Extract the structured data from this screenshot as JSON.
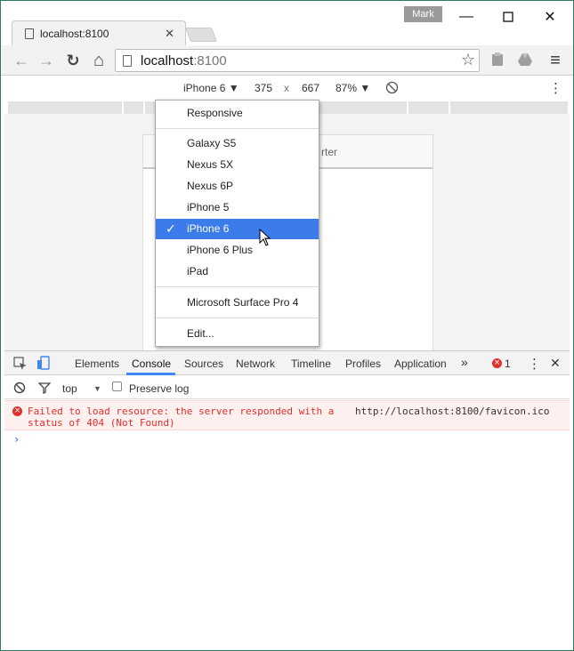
{
  "window": {
    "profile_name": "Mark",
    "minimize_glyph": "—",
    "maximize_glyph": "☐",
    "close_glyph": "✕"
  },
  "tab": {
    "title": "localhost:8100",
    "close_glyph": "✕"
  },
  "toolbar": {
    "back_glyph": "←",
    "forward_glyph": "→",
    "reload_glyph": "↻",
    "home_glyph": "⌂",
    "url_host": "localhost",
    "url_port": ":8100",
    "star_glyph": "☆",
    "menu_glyph": "≡"
  },
  "device_toolbar": {
    "device": "iPhone 6 ▼",
    "width": "375",
    "times": "x",
    "height": "667",
    "zoom": "87% ▼",
    "more_glyph": "⋮"
  },
  "page": {
    "header_partial": "rter"
  },
  "device_menu": {
    "items": [
      {
        "label": "Responsive"
      },
      {
        "label": "Galaxy S5"
      },
      {
        "label": "Nexus 5X"
      },
      {
        "label": "Nexus 6P"
      },
      {
        "label": "iPhone 5"
      },
      {
        "label": "iPhone 6",
        "selected": true
      },
      {
        "label": "iPhone 6 Plus"
      },
      {
        "label": "iPad"
      },
      {
        "label": "Microsoft Surface Pro 4"
      },
      {
        "label": "Edit..."
      }
    ]
  },
  "devtools": {
    "tabs": [
      "Elements",
      "Console",
      "Sources",
      "Network",
      "Timeline",
      "Profiles",
      "Application"
    ],
    "active_tab": "Console",
    "overflow_glyph": "»",
    "error_count": "1",
    "more_glyph": "⋮",
    "close_glyph": "✕",
    "context": "top",
    "context_arrow": "▼",
    "preserve_log_label": "Preserve log",
    "error_message_line1": "Failed to load resource: the server responded with a",
    "error_message_line2": "status of 404 (Not Found)",
    "error_source": "http://localhost:8100/favicon.ico",
    "error_icon_glyph": "×",
    "prompt_glyph": "›"
  },
  "colors": {
    "accent": "#3b7bea",
    "error": "#e0302a",
    "tab_underline": "#4285f4"
  }
}
